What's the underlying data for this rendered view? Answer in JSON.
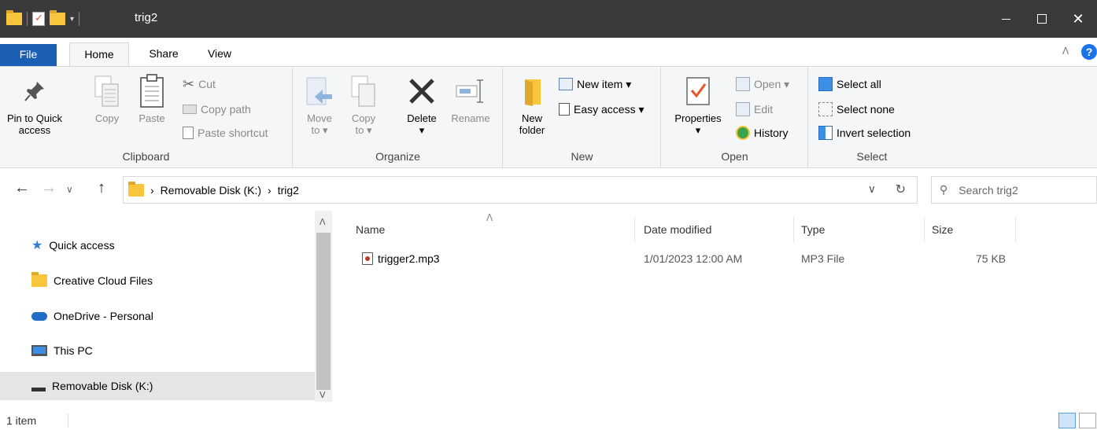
{
  "window": {
    "title": "trig2",
    "controls": {
      "minimize": "",
      "maximize": "",
      "close": "✕"
    }
  },
  "ribbon_tabs": {
    "file": "File",
    "home": "Home",
    "share": "Share",
    "view": "View"
  },
  "ribbon": {
    "clipboard": {
      "label": "Clipboard",
      "pin_line1": "Pin to Quick",
      "pin_line2": "access",
      "copy": "Copy",
      "paste": "Paste",
      "cut": "Cut",
      "copy_path": "Copy path",
      "paste_shortcut": "Paste shortcut"
    },
    "organize": {
      "label": "Organize",
      "move_line1": "Move",
      "move_line2": "to ▾",
      "copy_line1": "Copy",
      "copy_line2": "to ▾",
      "delete": "Delete",
      "delete_dd": "▾",
      "rename": "Rename"
    },
    "new": {
      "label": "New",
      "folder_line1": "New",
      "folder_line2": "folder",
      "new_item": "New item ▾",
      "easy_access": "Easy access ▾"
    },
    "open": {
      "label": "Open",
      "properties": "Properties",
      "properties_dd": "▾",
      "open": "Open ▾",
      "edit": "Edit",
      "history": "History"
    },
    "select": {
      "label": "Select",
      "select_all": "Select all",
      "select_none": "Select none",
      "invert": "Invert selection"
    }
  },
  "address": {
    "crumbs": [
      "Removable Disk (K:)",
      "trig2"
    ],
    "search_placeholder": "Search trig2"
  },
  "nav_pane": {
    "items": [
      {
        "label": "Quick access"
      },
      {
        "label": "Creative Cloud Files"
      },
      {
        "label": "OneDrive - Personal"
      },
      {
        "label": "This PC"
      },
      {
        "label": "Removable Disk (K:)"
      }
    ]
  },
  "file_list": {
    "columns": [
      "Name",
      "Date modified",
      "Type",
      "Size"
    ],
    "rows": [
      {
        "name": "trigger2.mp3",
        "date": "1/01/2023 12:00 AM",
        "type": "MP3 File",
        "size": "75 KB"
      }
    ]
  },
  "status": {
    "count": "1 item"
  },
  "colors": {
    "accent": "#1a5fb4",
    "titlebar": "#3a3a3a",
    "ribbon_bg": "#f5f6f7",
    "selected": "#e5e5e5"
  }
}
